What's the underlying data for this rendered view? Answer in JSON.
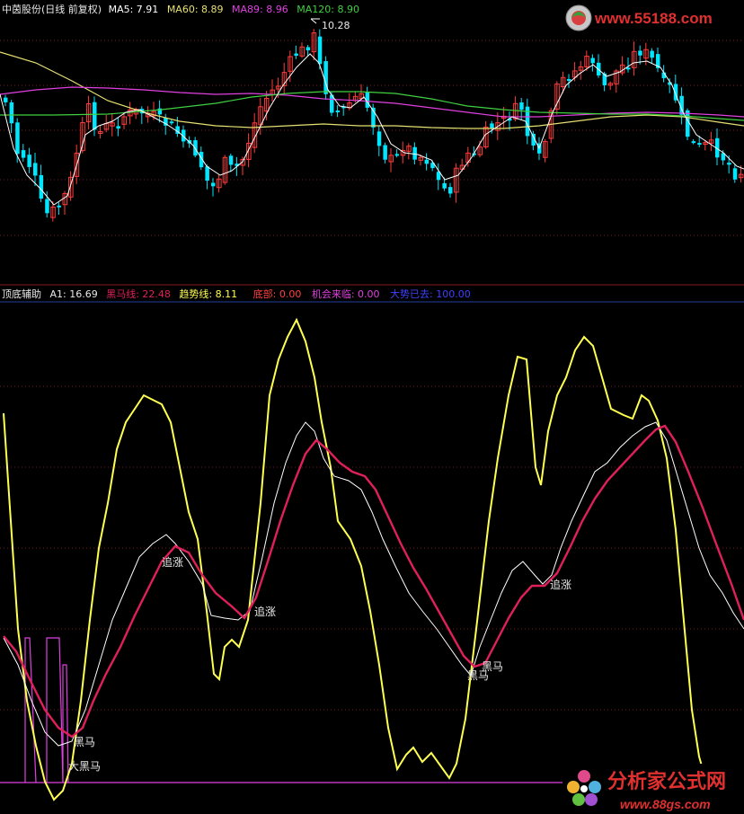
{
  "header": {
    "title": "中茵股份(日线 前复权)",
    "ma5": "MA5: 7.91",
    "ma60": "MA60: 8.89",
    "ma89": "MA89: 8.96",
    "ma120": "MA120: 8.90",
    "peak_label": "10.28"
  },
  "indicator_header": {
    "name": "顶底辅助",
    "a1": "A1: 16.69",
    "heima": "黑马线: 22.48",
    "qushi": "趋势线: 8.11",
    "dibu": "底部: 0.00",
    "jihui": "机会来临: 0.00",
    "dashi": "大势已去: 100.00"
  },
  "watermarks": {
    "top": "www.55188.com",
    "bottom_title": "分析家公式网",
    "bottom_url": "www.88gs.com"
  },
  "colors": {
    "up": "#ff3c3c",
    "down": "#00e6ff",
    "ma5": "#ffffff",
    "ma60": "#e6e070",
    "ma89": "#e040e0",
    "ma120": "#40d040",
    "yellow": "#ffff50",
    "red": "#e0205a",
    "magenta": "#e040e0"
  },
  "chart_data": [
    {
      "type": "candlestick",
      "title": "中茵股份(日线 前复权)",
      "series": [
        {
          "name": "MA5",
          "value": 7.91
        },
        {
          "name": "MA60",
          "value": 8.89
        },
        {
          "name": "MA89",
          "value": 8.96
        },
        {
          "name": "MA120",
          "value": 8.9
        }
      ],
      "annotations": [
        {
          "text": "10.28"
        }
      ]
    },
    {
      "type": "line",
      "title": "顶底辅助",
      "series": [
        {
          "name": "A1",
          "value": 16.69
        },
        {
          "name": "黑马线",
          "value": 22.48
        },
        {
          "name": "趋势线",
          "value": 8.11
        },
        {
          "name": "底部",
          "value": 0.0
        },
        {
          "name": "机会来临",
          "value": 0.0
        },
        {
          "name": "大势已去",
          "value": 100.0
        }
      ],
      "annotations": [
        {
          "text": "追涨"
        },
        {
          "text": "追涨"
        },
        {
          "text": "追涨"
        },
        {
          "text": "黑马"
        },
        {
          "text": "黑马"
        },
        {
          "text": "黑马"
        },
        {
          "text": "大黑马"
        }
      ]
    }
  ]
}
